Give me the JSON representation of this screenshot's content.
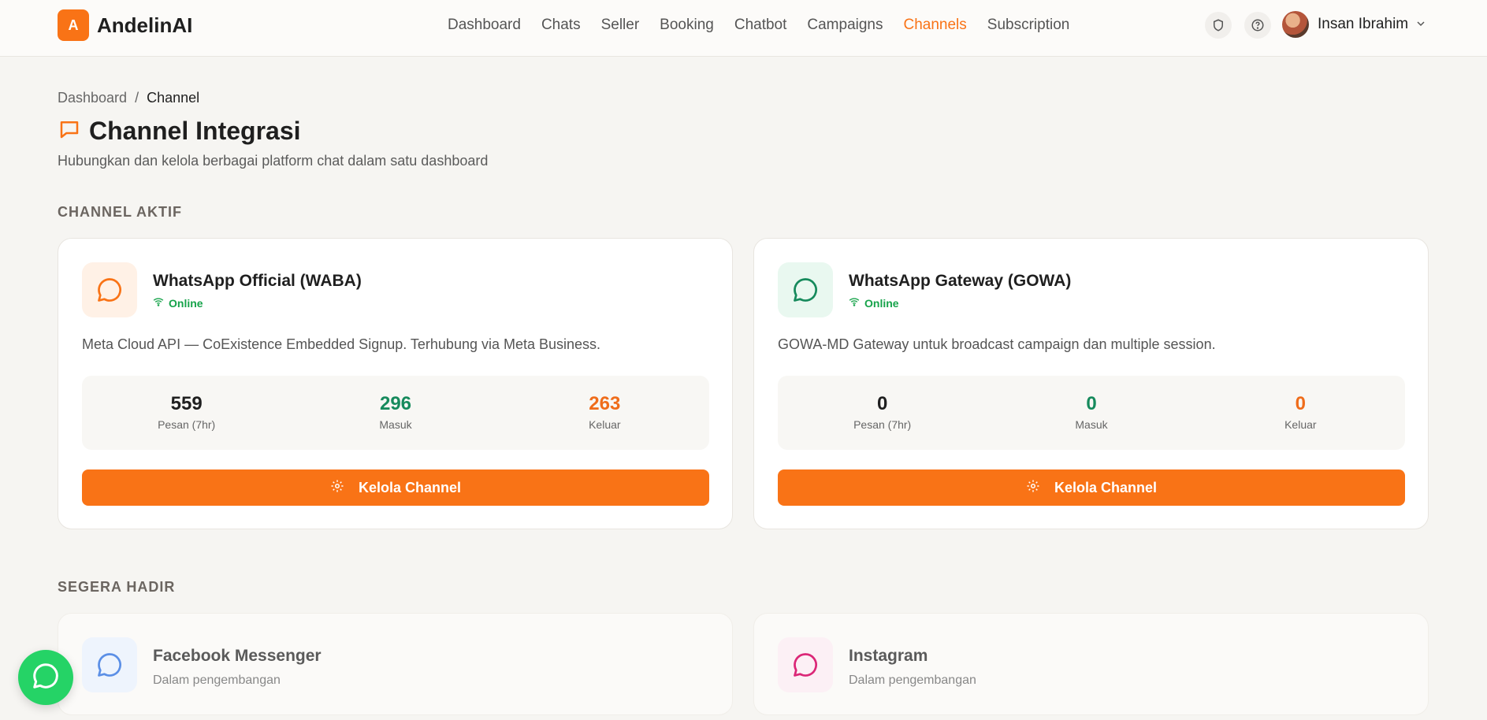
{
  "header": {
    "logo_letter": "A",
    "brand": "AndelinAI",
    "nav": [
      {
        "label": "Dashboard"
      },
      {
        "label": "Chats"
      },
      {
        "label": "Seller"
      },
      {
        "label": "Booking"
      },
      {
        "label": "Chatbot"
      },
      {
        "label": "Campaigns"
      },
      {
        "label": "Channels",
        "active": true
      },
      {
        "label": "Subscription"
      }
    ],
    "user_name": "Insan Ibrahim",
    "icons": [
      "shield-icon",
      "help-icon",
      "chevron-down-icon"
    ]
  },
  "breadcrumb": {
    "root": "Dashboard",
    "separator": "/",
    "current": "Channel"
  },
  "page": {
    "title": "Channel Integrasi",
    "subtitle": "Hubungkan dan kelola berbagai platform chat dalam satu dashboard"
  },
  "sections": {
    "active_label": "CHANNEL AKTIF",
    "soon_label": "SEGERA HADIR"
  },
  "active_channels": [
    {
      "title": "WhatsApp Official (WABA)",
      "status": "Online",
      "description": "Meta Cloud API — CoExistence Embedded Signup. Terhubung via Meta Business.",
      "stats": [
        {
          "value": "559",
          "label": "Pesan (7hr)"
        },
        {
          "value": "296",
          "label": "Masuk"
        },
        {
          "value": "263",
          "label": "Keluar"
        }
      ],
      "button": "Kelola Channel",
      "accent": "#f97316"
    },
    {
      "title": "WhatsApp Gateway (GOWA)",
      "status": "Online",
      "description": "GOWA-MD Gateway untuk broadcast campaign dan multiple session.",
      "stats": [
        {
          "value": "0",
          "label": "Pesan (7hr)"
        },
        {
          "value": "0",
          "label": "Masuk"
        },
        {
          "value": "0",
          "label": "Keluar"
        }
      ],
      "button": "Kelola Channel",
      "accent": "#16a34a"
    }
  ],
  "coming_soon": [
    {
      "title": "Facebook Messenger",
      "subtitle": "Dalam pengembangan",
      "accent": "#3b82f6"
    },
    {
      "title": "Instagram",
      "subtitle": "Dalam pengembangan",
      "accent": "#db2777"
    }
  ],
  "colors": {
    "brand": "#f97316",
    "online": "#16a34a",
    "whatsapp_fab": "#25d366"
  }
}
